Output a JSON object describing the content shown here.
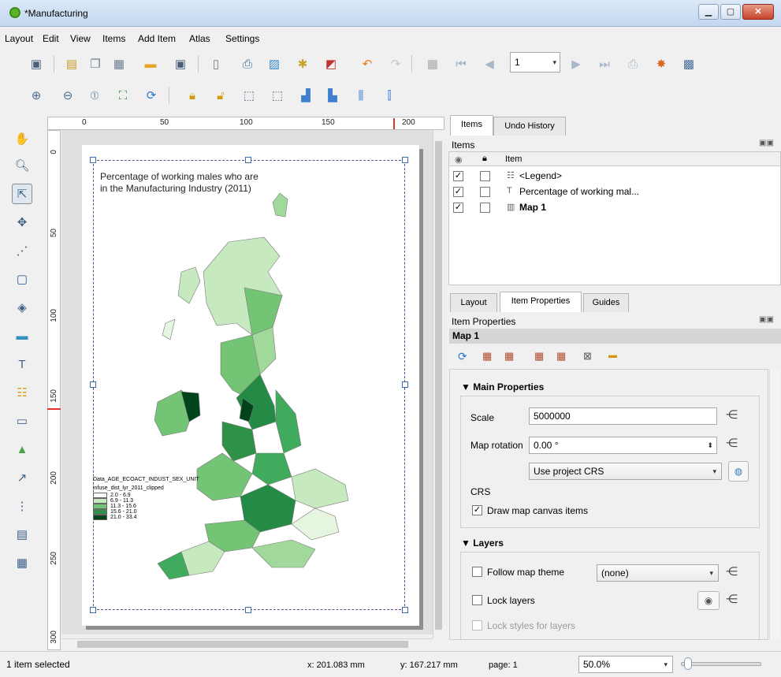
{
  "window": {
    "title": "*Manufacturing",
    "min": "▁",
    "max": "▢",
    "close": "✕"
  },
  "menu": [
    "Layout",
    "Edit",
    "View",
    "Items",
    "Add Item",
    "Atlas",
    "Settings"
  ],
  "toolbar1": {
    "page_value": "1"
  },
  "ruler": {
    "h_marks": [
      "0",
      "50",
      "100",
      "150",
      "200"
    ],
    "v_marks": [
      "0",
      "50",
      "100",
      "150",
      "200",
      "250",
      "300"
    ]
  },
  "map": {
    "title_line1": "Percentage of working males who are",
    "title_line2": "in the Manufacturing Industry (2011)",
    "legend_title": "Data_AGE_ECOACT_INDUST_SEX_UNIT",
    "legend_layer": "infuse_dist_lyr_2011_clipped",
    "classes": [
      {
        "label": "2.0 - 6.9",
        "color": "#f7fcf5"
      },
      {
        "label": "6.9 - 11.3",
        "color": "#c7e9c0"
      },
      {
        "label": "11.3 - 15.6",
        "color": "#74c476"
      },
      {
        "label": "15.6 - 21.0",
        "color": "#2e9145"
      },
      {
        "label": "21.0 - 33.4",
        "color": "#00441b"
      }
    ]
  },
  "items_panel": {
    "tabs": [
      "Items",
      "Undo History"
    ],
    "heading": "Items",
    "col_item": "Item",
    "rows": [
      {
        "label": "<Legend>",
        "icon": "legend-icon",
        "checked": "✓"
      },
      {
        "label": "Percentage of working mal...",
        "icon": "text-icon",
        "checked": "✓"
      },
      {
        "label": "Map 1",
        "icon": "map-icon",
        "checked": "✓"
      }
    ]
  },
  "props_panel": {
    "tabs": [
      "Layout",
      "Item Properties",
      "Guides"
    ],
    "heading": "Item Properties",
    "item_name": "Map 1",
    "main_section": "Main Properties",
    "scale_label": "Scale",
    "scale_value": "5000000",
    "rotation_label": "Map rotation",
    "rotation_value": "0.00 °",
    "crs_combo": "Use project CRS",
    "crs_label": "CRS",
    "draw_items_label": "Draw map canvas items",
    "layers_section": "Layers",
    "follow_theme_label": "Follow map theme",
    "theme_value": "(none)",
    "lock_layers_label": "Lock layers",
    "lock_styles_label": "Lock styles for layers"
  },
  "status": {
    "selected": "1 item selected",
    "x": "x: 201.083 mm",
    "y": "y: 167.217 mm",
    "page": "page: 1",
    "zoom": "50.0%"
  }
}
